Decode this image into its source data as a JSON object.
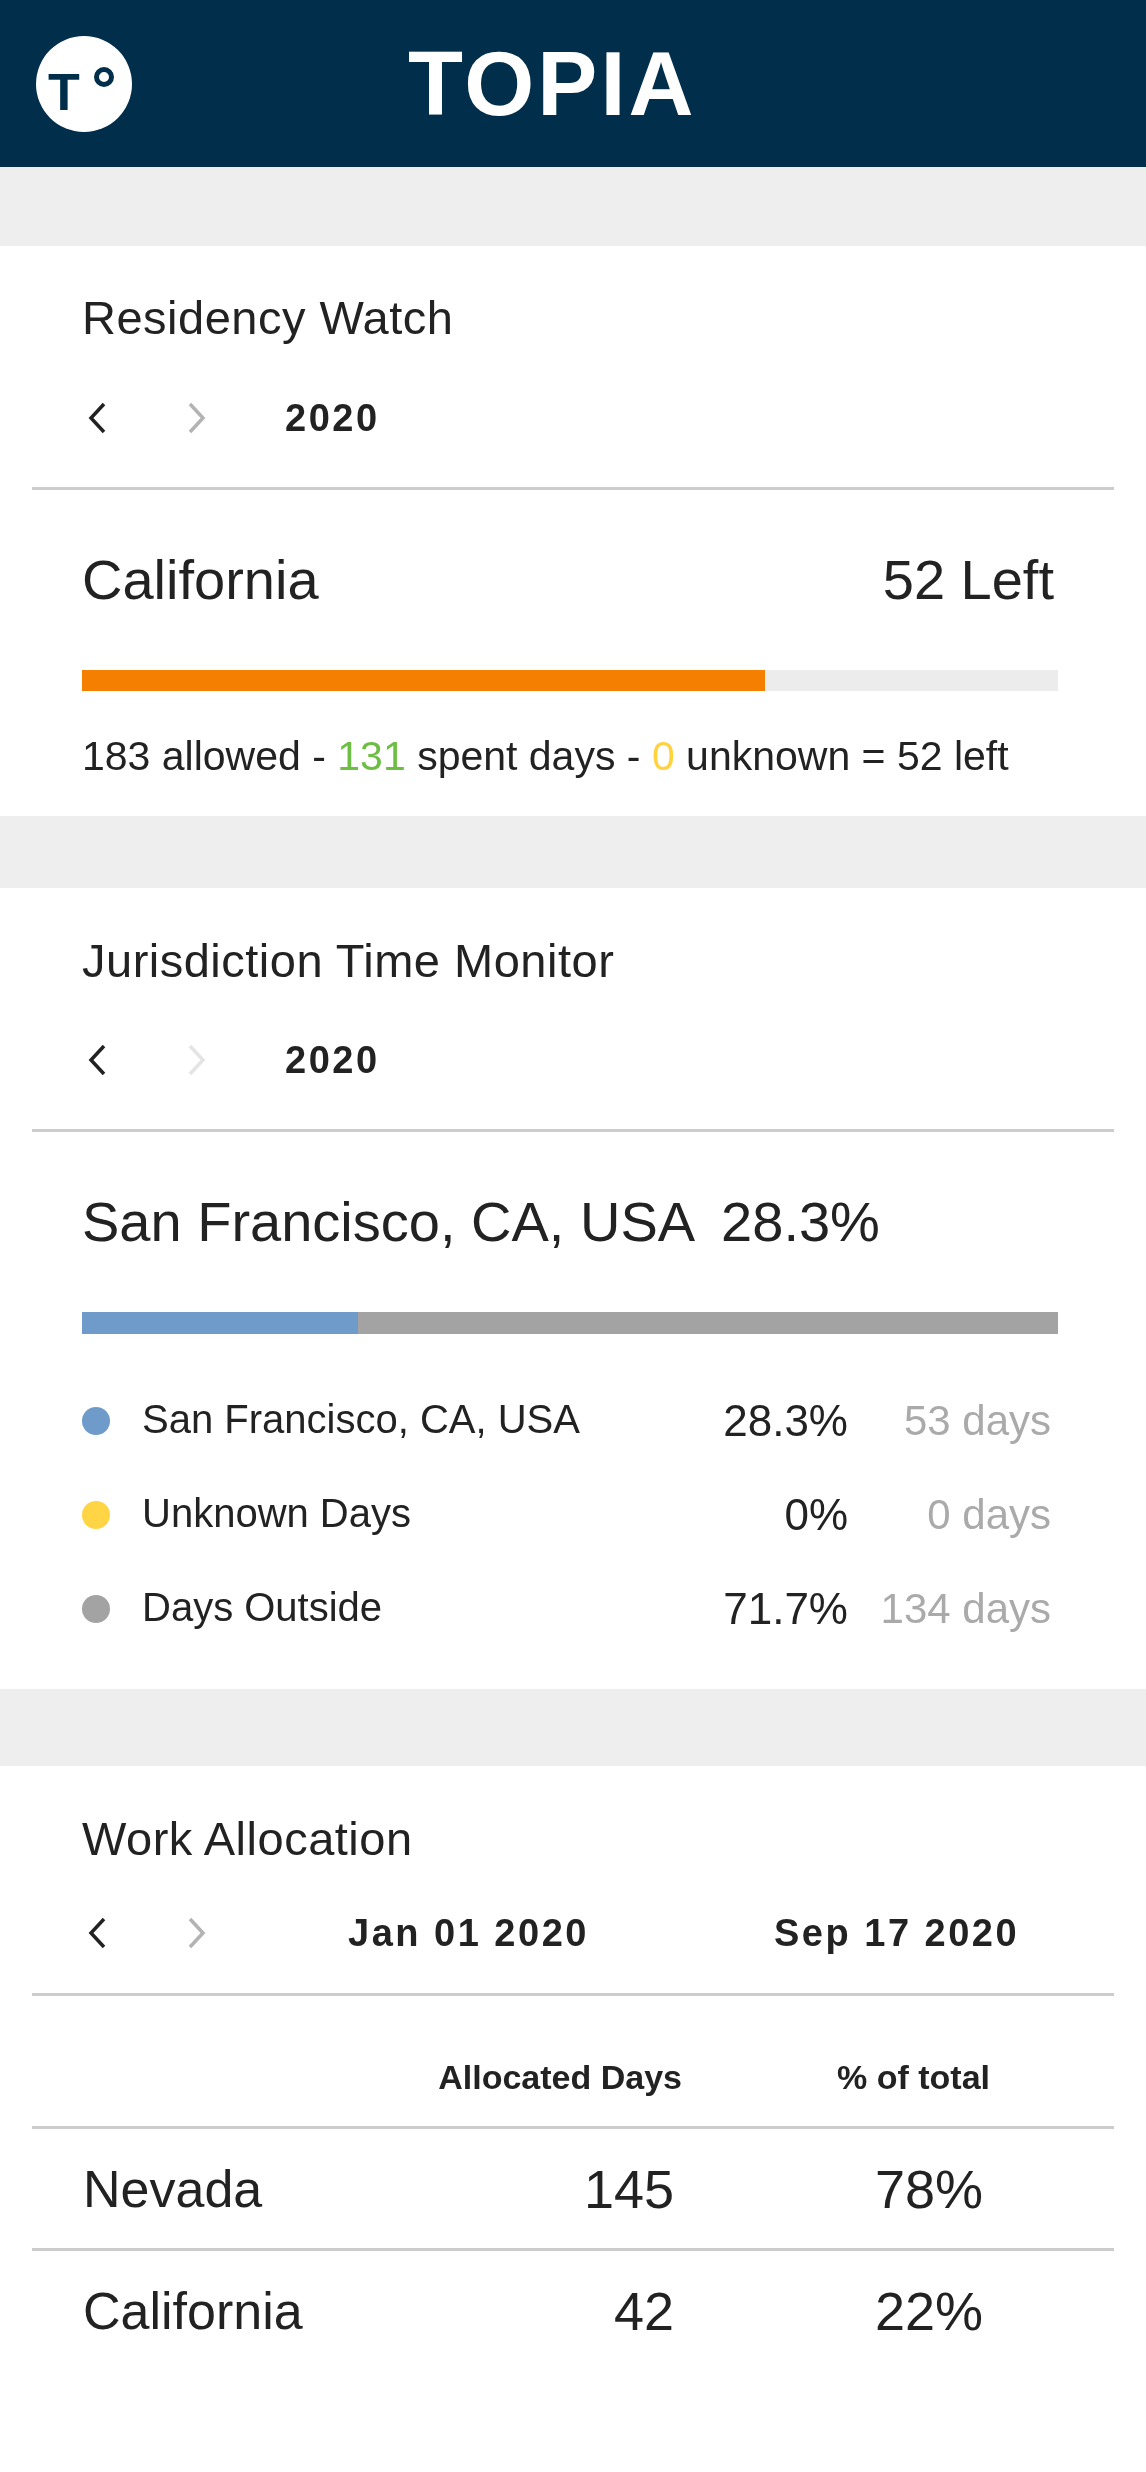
{
  "header": {
    "logo_letter": "T",
    "title": "TOPIA"
  },
  "residency_watch": {
    "title": "Residency Watch",
    "next_disabled": false,
    "period": "2020",
    "jurisdiction": "California",
    "remaining": "52 Left",
    "level": 0.7,
    "summary": [
      {
        "kind": "plain",
        "text": "183 allowed -"
      },
      {
        "kind": "spent",
        "text": "131"
      },
      {
        "kind": "plain",
        "text": "spent days -"
      },
      {
        "kind": "unknown",
        "text": "0"
      },
      {
        "kind": "plain",
        "text": "unknown = 52 left"
      }
    ]
  },
  "jurisdiction_monitor": {
    "title": "Jurisdiction Time Monitor",
    "next_disabled": true,
    "period": "2020",
    "location": "San Francisco, CA, USA",
    "share": "28.3%",
    "breakdown": [
      {
        "label": "San Francisco, CA, USA",
        "percent": "28.3%",
        "days": "53 days",
        "color": "#6e9bc9",
        "level": 0.283
      },
      {
        "label": "Unknown Days",
        "percent": "0%",
        "days": "0 days",
        "color": "#ffd445",
        "level": 0
      },
      {
        "label": "Days Outside",
        "percent": "71.7%",
        "days": "134 days",
        "color": "#a3a3a3",
        "level": 0.717
      }
    ]
  },
  "work_allocation": {
    "title": "Work Allocation",
    "next_disabled": false,
    "start_date": "Jan 01 2020",
    "end_date": "Sep 17 2020",
    "columns": [
      "Allocated Days",
      "% of total"
    ],
    "rows": [
      {
        "jurisdiction": "Nevada",
        "days": "145",
        "share": "78%"
      },
      {
        "jurisdiction": "California",
        "days": "42",
        "share": "22%"
      }
    ]
  }
}
